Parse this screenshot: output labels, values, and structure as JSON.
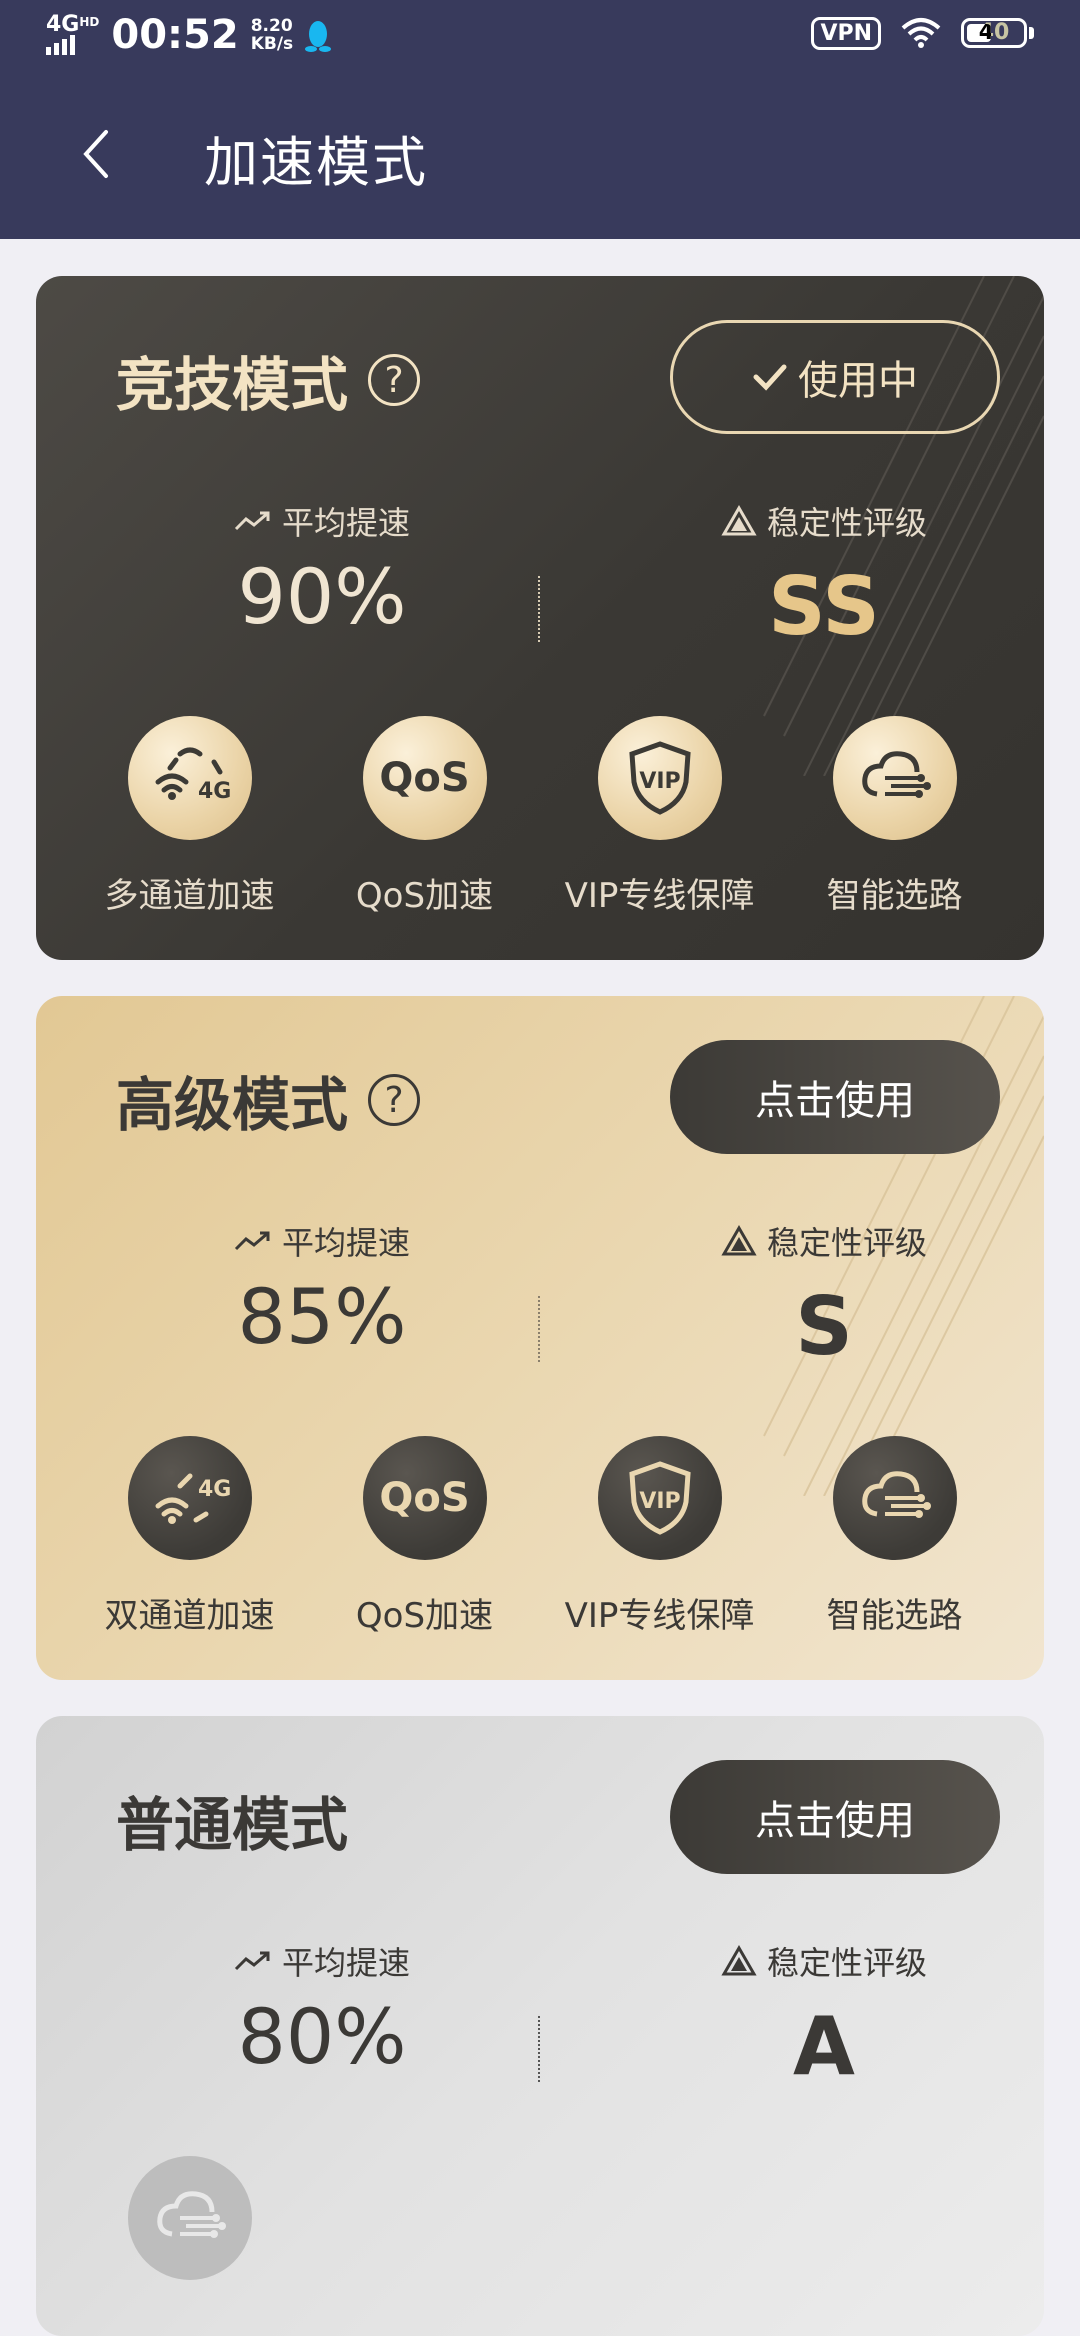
{
  "status_bar": {
    "network": "4G",
    "network_badge": "HD",
    "time": "00:52",
    "speed_value": "8.20",
    "speed_unit": "KB/s",
    "vpn": "VPN",
    "battery": "40"
  },
  "header": {
    "title": "加速模式"
  },
  "cards": [
    {
      "title": "竞技模式",
      "button": "使用中",
      "button_state": "active",
      "speed_label": "平均提速",
      "speed_value": "90%",
      "stability_label": "稳定性评级",
      "stability_value": "SS",
      "features": [
        {
          "icon": "multi-channel-icon",
          "label": "多通道加速"
        },
        {
          "icon": "qos-icon",
          "label": "QoS加速"
        },
        {
          "icon": "vip-shield-icon",
          "label": "VIP专线保障"
        },
        {
          "icon": "smart-route-icon",
          "label": "智能选路"
        }
      ]
    },
    {
      "title": "高级模式",
      "button": "点击使用",
      "speed_label": "平均提速",
      "speed_value": "85%",
      "stability_label": "稳定性评级",
      "stability_value": "S",
      "features": [
        {
          "icon": "dual-channel-icon",
          "label": "双通道加速"
        },
        {
          "icon": "qos-icon",
          "label": "QoS加速"
        },
        {
          "icon": "vip-shield-icon",
          "label": "VIP专线保障"
        },
        {
          "icon": "smart-route-icon",
          "label": "智能选路"
        }
      ]
    },
    {
      "title": "普通模式",
      "button": "点击使用",
      "speed_label": "平均提速",
      "speed_value": "80%",
      "stability_label": "稳定性评级",
      "stability_value": "A",
      "features": [
        {
          "icon": "smart-route-icon"
        }
      ]
    }
  ],
  "colors": {
    "header_bg": "#383a5c",
    "page_bg": "#f0eff4",
    "gold_accent": "#e6c68a",
    "dark_card": "#3a3834"
  }
}
